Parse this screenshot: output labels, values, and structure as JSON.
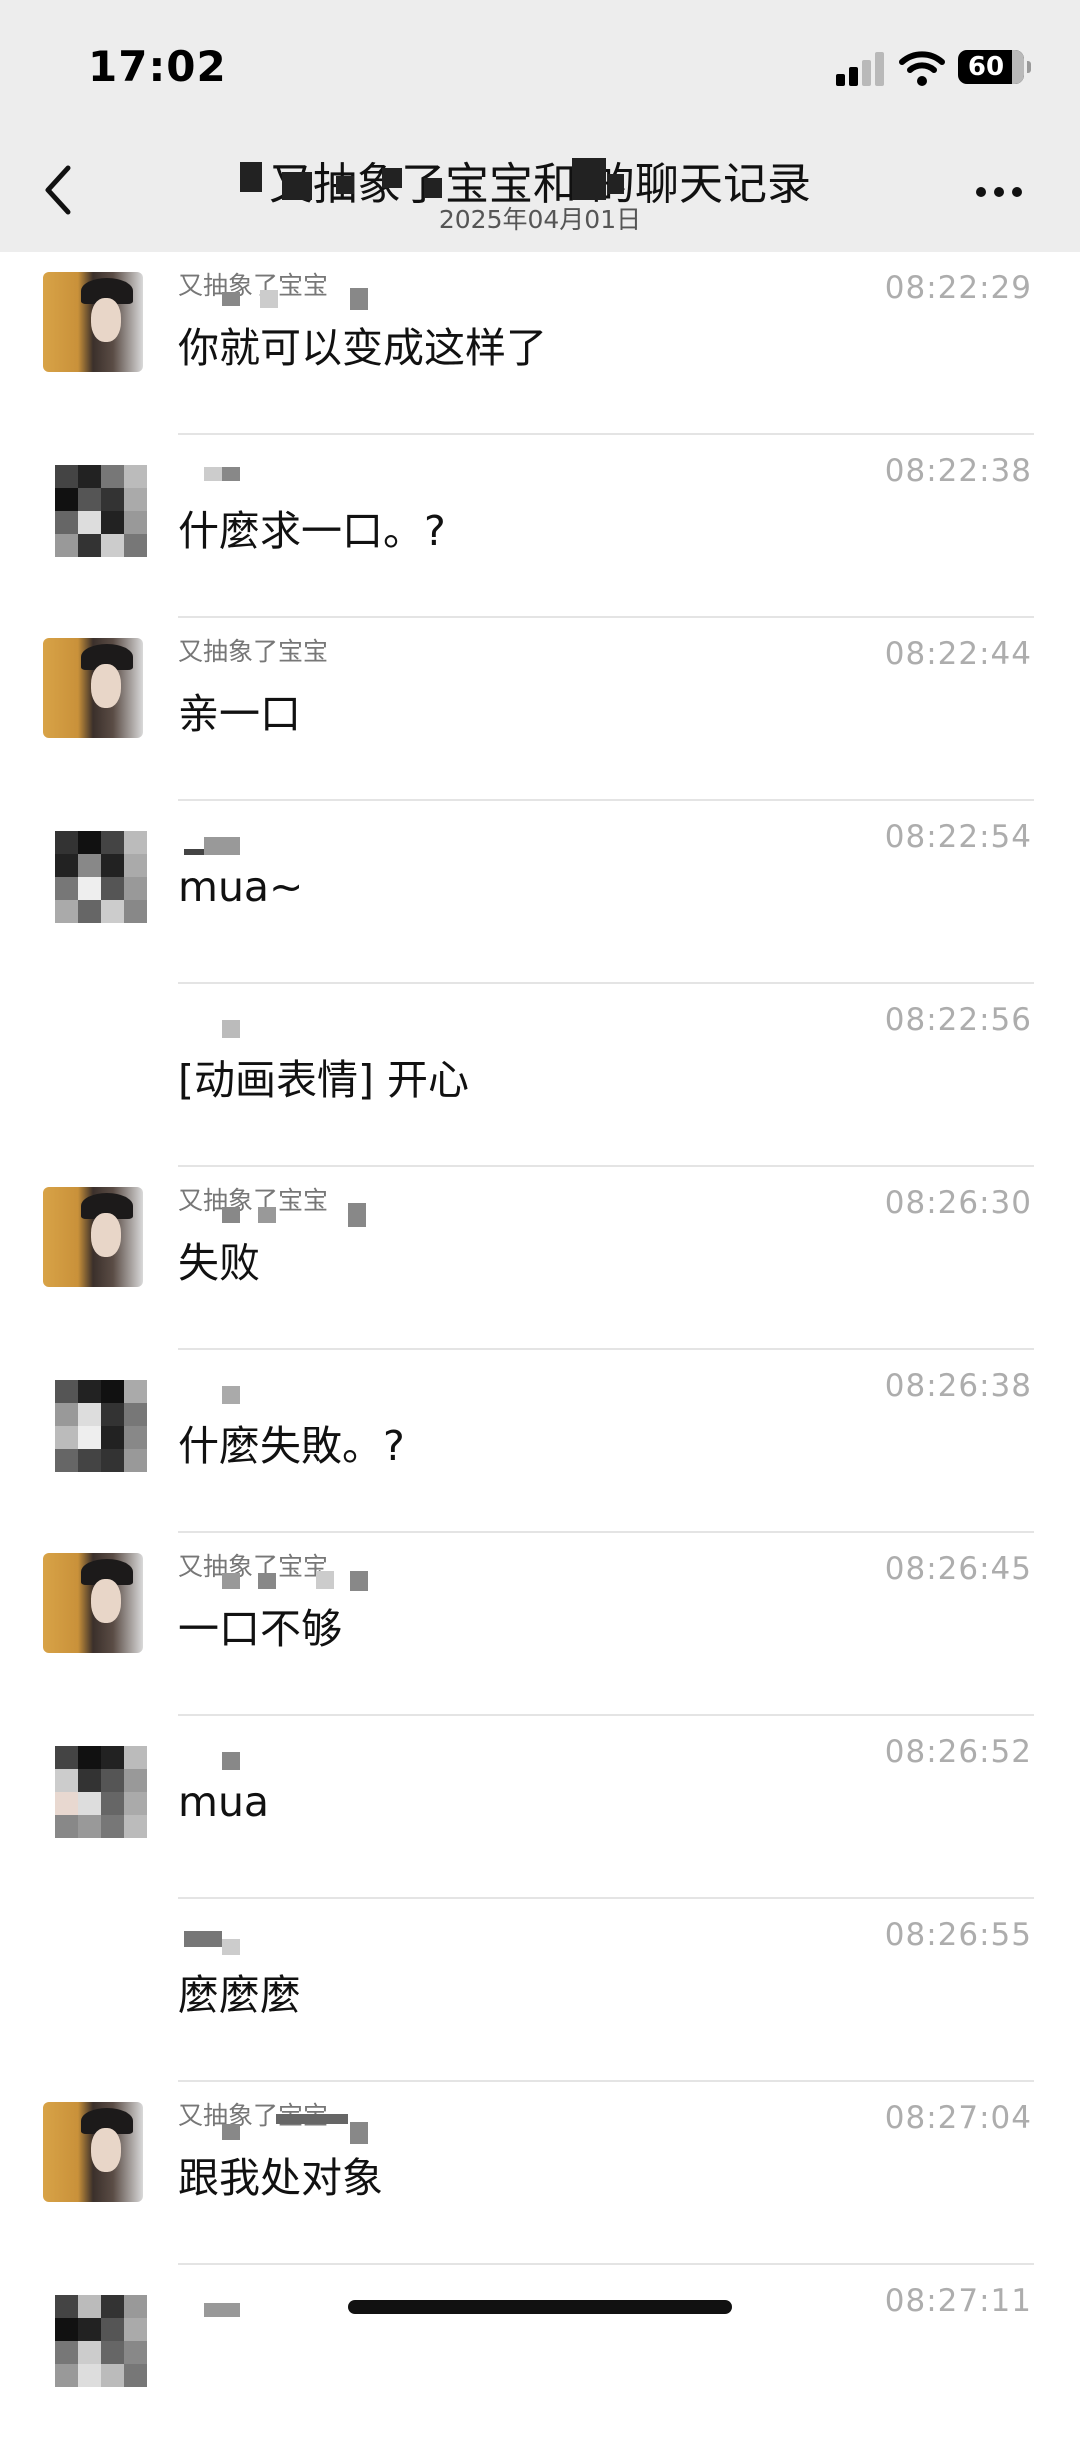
{
  "status_bar": {
    "time": "17:02",
    "battery": "60"
  },
  "header": {
    "title": "又抽象了宝宝和 的聊天记录",
    "subtitle": "2025年04月01日"
  },
  "messages": [
    {
      "avatar": "girl-photo",
      "sender": "又抽象了宝宝",
      "time": "08:22:29",
      "text": "你就可以变成这样了"
    },
    {
      "avatar": "mosaic",
      "sender": "",
      "time": "08:22:38",
      "text": "什麼求一口。?"
    },
    {
      "avatar": "girl-photo",
      "sender": "又抽象了宝宝",
      "time": "08:22:44",
      "text": "亲一口"
    },
    {
      "avatar": "mosaic",
      "sender": "",
      "time": "08:22:54",
      "text": "mua~"
    },
    {
      "avatar": "none",
      "sender": "",
      "time": "08:22:56",
      "text": "[动画表情] 开心"
    },
    {
      "avatar": "girl-photo",
      "sender": "又抽象了宝宝",
      "time": "08:26:30",
      "text": "失败"
    },
    {
      "avatar": "mosaic",
      "sender": "",
      "time": "08:26:38",
      "text": "什麼失敗。?"
    },
    {
      "avatar": "girl-photo",
      "sender": "又抽象了宝宝",
      "time": "08:26:45",
      "text": "一口不够"
    },
    {
      "avatar": "mosaic",
      "sender": "",
      "time": "08:26:52",
      "text": "mua"
    },
    {
      "avatar": "none",
      "sender": "",
      "time": "08:26:55",
      "text": "麼麼麼"
    },
    {
      "avatar": "girl-photo",
      "sender": "又抽象了宝宝",
      "time": "08:27:04",
      "text": "跟我处对象"
    },
    {
      "avatar": "mosaic",
      "sender": "",
      "time": "08:27:11",
      "text": ""
    }
  ]
}
